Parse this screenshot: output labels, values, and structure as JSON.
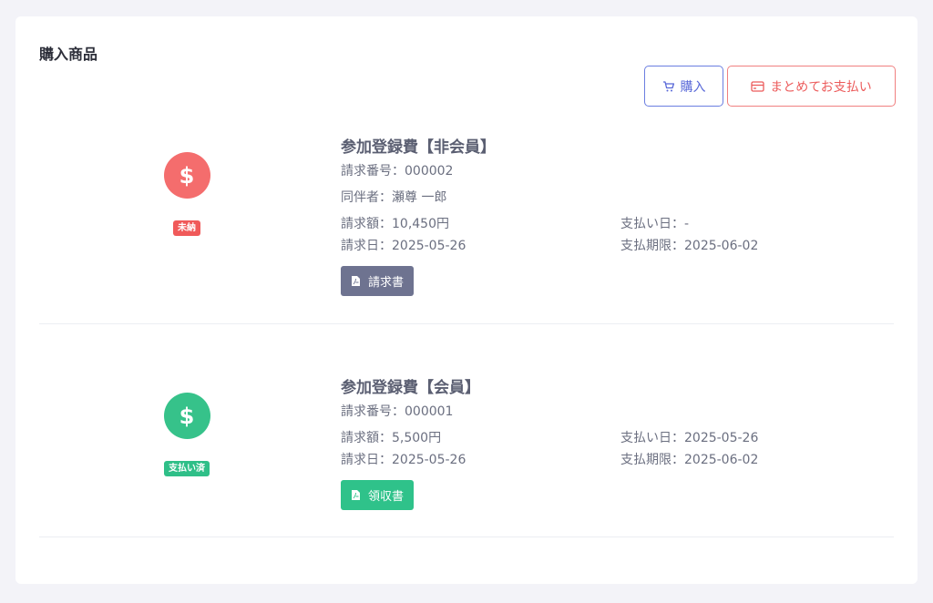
{
  "page": {
    "title": "購入商品"
  },
  "actions": {
    "buy_label": "購入",
    "pay_all_label": "まとめてお支払い"
  },
  "items": [
    {
      "status": "未納",
      "status_color": "#f05a5a",
      "title": "参加登録費【非会員】",
      "invoice_no": "請求番号：000002",
      "companion": "同伴者：瀬尊 一郎",
      "amount": "請求額：10,450円",
      "paid_date": "支払い日：-",
      "invoice_date": "請求日：2025-05-26",
      "due_date": "支払期限：2025-06-02",
      "doc_label": "請求書",
      "coin_icon": "dollar-icon"
    },
    {
      "status": "支払い済",
      "status_color": "#2fbf88",
      "title": "参加登録費【会員】",
      "invoice_no": "請求番号：000001",
      "amount": "請求額：5,500円",
      "paid_date": "支払い日：2025-05-26",
      "invoice_date": "請求日：2025-05-26",
      "due_date": "支払期限：2025-06-02",
      "doc_label": "領収書",
      "coin_icon": "dollar-icon"
    }
  ]
}
